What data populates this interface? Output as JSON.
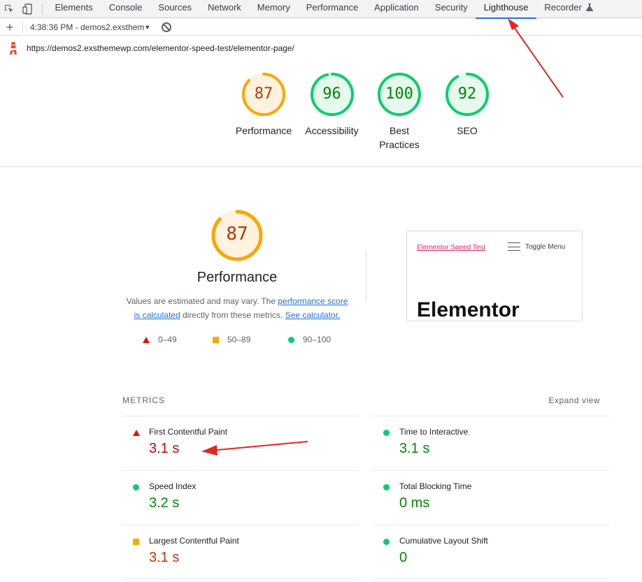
{
  "devtools": {
    "tabs": [
      "Elements",
      "Console",
      "Sources",
      "Network",
      "Memory",
      "Performance",
      "Application",
      "Security",
      "Lighthouse",
      "Recorder"
    ],
    "active_tab": "Lighthouse"
  },
  "toolbar": {
    "report_label": "4:38:36 PM - demos2.exsthem"
  },
  "url": "https://demos2.exsthemewp.com/elementor-speed-test/elementor-page/",
  "scores": {
    "performance": {
      "value": "87",
      "label": "Performance",
      "fraction": 0.87,
      "color": "#ffa400",
      "text_color": "#c33300"
    },
    "accessibility": {
      "value": "96",
      "label": "Accessibility",
      "fraction": 0.96,
      "color": "#0cce6b",
      "text_color": "#008800"
    },
    "best_practices": {
      "value": "100",
      "label_line1": "Best",
      "label_line2": "Practices",
      "fraction": 1.0,
      "color": "#0cce6b",
      "text_color": "#008800"
    },
    "seo": {
      "value": "92",
      "label": "SEO",
      "fraction": 0.92,
      "color": "#0cce6b",
      "text_color": "#008800"
    }
  },
  "performance_section": {
    "score": "87",
    "title": "Performance",
    "desc_1": "Values are estimated and may vary. The ",
    "link_1a": "performance score",
    "link_1b": "is calculated",
    "desc_2": " directly from these metrics. ",
    "link_2": "See calculator.",
    "legend": {
      "fail": "0–49",
      "average": "50–89",
      "pass": "90–100"
    }
  },
  "screenshot_preview": {
    "site_title": "Elementor Speed Test",
    "menu_label": "Toggle Menu",
    "headline": "Elementor"
  },
  "metrics": {
    "heading": "METRICS",
    "expand": "Expand view",
    "fcp": {
      "label": "First Contentful Paint",
      "value": "3.1 s",
      "status": "fail"
    },
    "tti": {
      "label": "Time to Interactive",
      "value": "3.1 s",
      "status": "pass"
    },
    "si": {
      "label": "Speed Index",
      "value": "3.2 s",
      "status": "pass"
    },
    "tbt": {
      "label": "Total Blocking Time",
      "value": "0 ms",
      "status": "pass"
    },
    "lcp": {
      "label": "Largest Contentful Paint",
      "value": "3.1 s",
      "status": "average"
    },
    "cls": {
      "label": "Cumulative Layout Shift",
      "value": "0",
      "status": "pass"
    }
  },
  "colors": {
    "fail": "#eb0f00",
    "fail_text": "#c00",
    "average": "#ffa400",
    "average_text": "#c33300",
    "pass": "#0cce6b",
    "pass_text": "#008800",
    "annotation_arrow": "#e8251b"
  }
}
